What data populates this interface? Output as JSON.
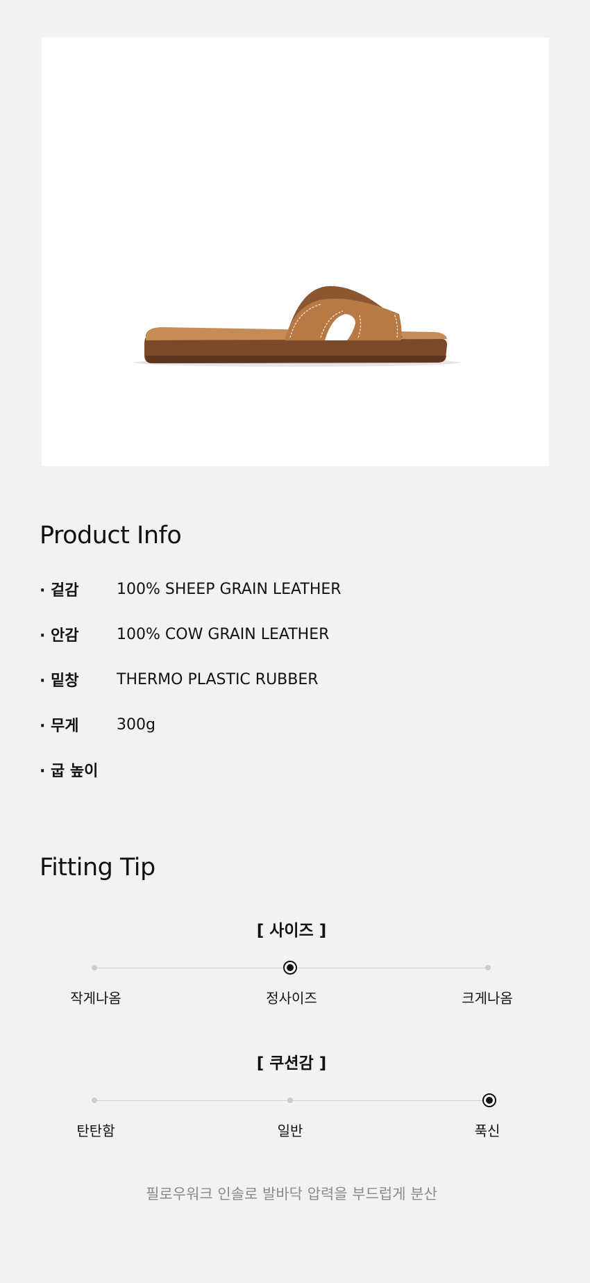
{
  "product_image": {
    "alt": "Brown leather slide sandal",
    "colors": {
      "leather": "#b87a45",
      "leather_dark": "#8c5630",
      "sole": "#7a4a28",
      "stitch": "#f2e3cf",
      "insole": "#c58c57"
    }
  },
  "product_info": {
    "title": "Product Info",
    "rows": [
      {
        "label": "· 겉감",
        "value": "100% SHEEP GRAIN LEATHER"
      },
      {
        "label": "· 안감",
        "value": "100% COW GRAIN LEATHER"
      },
      {
        "label": "· 밑창",
        "value": "THERMO PLASTIC RUBBER"
      },
      {
        "label": "· 무게",
        "value": "300g"
      },
      {
        "label": "· 굽 높이",
        "value": ""
      }
    ]
  },
  "fitting_tip": {
    "title": "Fitting Tip",
    "size": {
      "heading": "[ 사이즈 ]",
      "options": [
        "작게나옴",
        "정사이즈",
        "크게나옴"
      ],
      "selected_index": 1
    },
    "cushion": {
      "heading": "[ 쿠션감 ]",
      "options": [
        "탄탄함",
        "일반",
        "푹신"
      ],
      "selected_index": 2
    },
    "note": "필로우워크 인솔로 발바닥 압력을 부드럽게 분산"
  }
}
